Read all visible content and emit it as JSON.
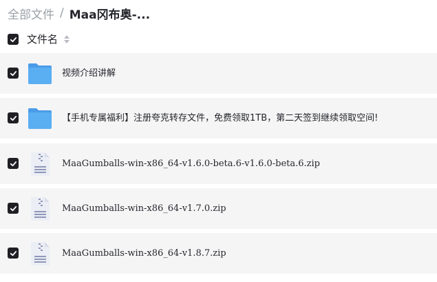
{
  "breadcrumb": {
    "root": "全部文件",
    "separator": "/",
    "current": "Maa冈布奥-..."
  },
  "list_header": {
    "name_column": "文件名",
    "checked": true
  },
  "files": [
    {
      "name": "视频介绍讲解",
      "type": "folder",
      "checked": true
    },
    {
      "name": "【手机专属福利】注册夸克转存文件，免费领取1TB，第二天签到继续领取空间!",
      "type": "folder",
      "checked": true
    },
    {
      "name": "MaaGumballs-win-x86_64-v1.6.0-beta.6-v1.6.0-beta.6.zip",
      "type": "zip",
      "checked": true
    },
    {
      "name": "MaaGumballs-win-x86_64-v1.7.0.zip",
      "type": "zip",
      "checked": true
    },
    {
      "name": "MaaGumballs-win-x86_64-v1.8.7.zip",
      "type": "zip",
      "checked": true
    }
  ],
  "colors": {
    "row_bg": "#f5f5f6",
    "checkbox": "#1f1f24",
    "folder_main": "#5aaef2",
    "folder_tab": "#4a9ce8",
    "zip_body": "#eceef5",
    "zip_accent": "#8e97b8"
  },
  "icons": {
    "checkbox": "check-icon",
    "sort": "sort-icon",
    "folder": "folder-icon",
    "zip": "zip-file-icon"
  }
}
